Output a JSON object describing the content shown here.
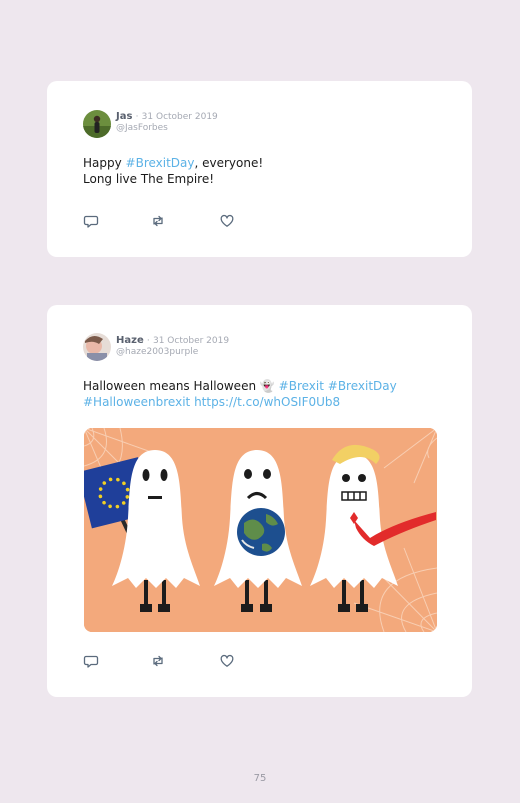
{
  "tweets": [
    {
      "name": "Jas",
      "sep": "·",
      "date": "31 October 2019",
      "handle": "@JasForbes",
      "line1_pre": "Happy ",
      "line1_tag": "#BrexitDay",
      "line1_post": ", everyone!",
      "line2": "Long live The Empire!"
    },
    {
      "name": "Haze",
      "sep": "·",
      "date": "31 October 2019",
      "handle": "@haze2003purple",
      "line1_pre": "Halloween means Halloween ",
      "emoji": "👻",
      "tag1": "#Brexit",
      "tag2": "#BrexitDay",
      "tag3": "#Halloweenbrexit",
      "link": "https://t.co/whOSIF0Ub8",
      "image_icon": "three-ghosts-brexit-image"
    }
  ],
  "icons": {
    "reply": "reply-icon",
    "retweet": "retweet-icon",
    "like": "heart-icon"
  },
  "colors": {
    "background": "#eee7ee",
    "hashtag": "#5cb2e6",
    "image_bg": "#f3a97c",
    "eu_blue": "#1f3f9a",
    "eu_gold": "#f2d024"
  },
  "page_number": "75"
}
